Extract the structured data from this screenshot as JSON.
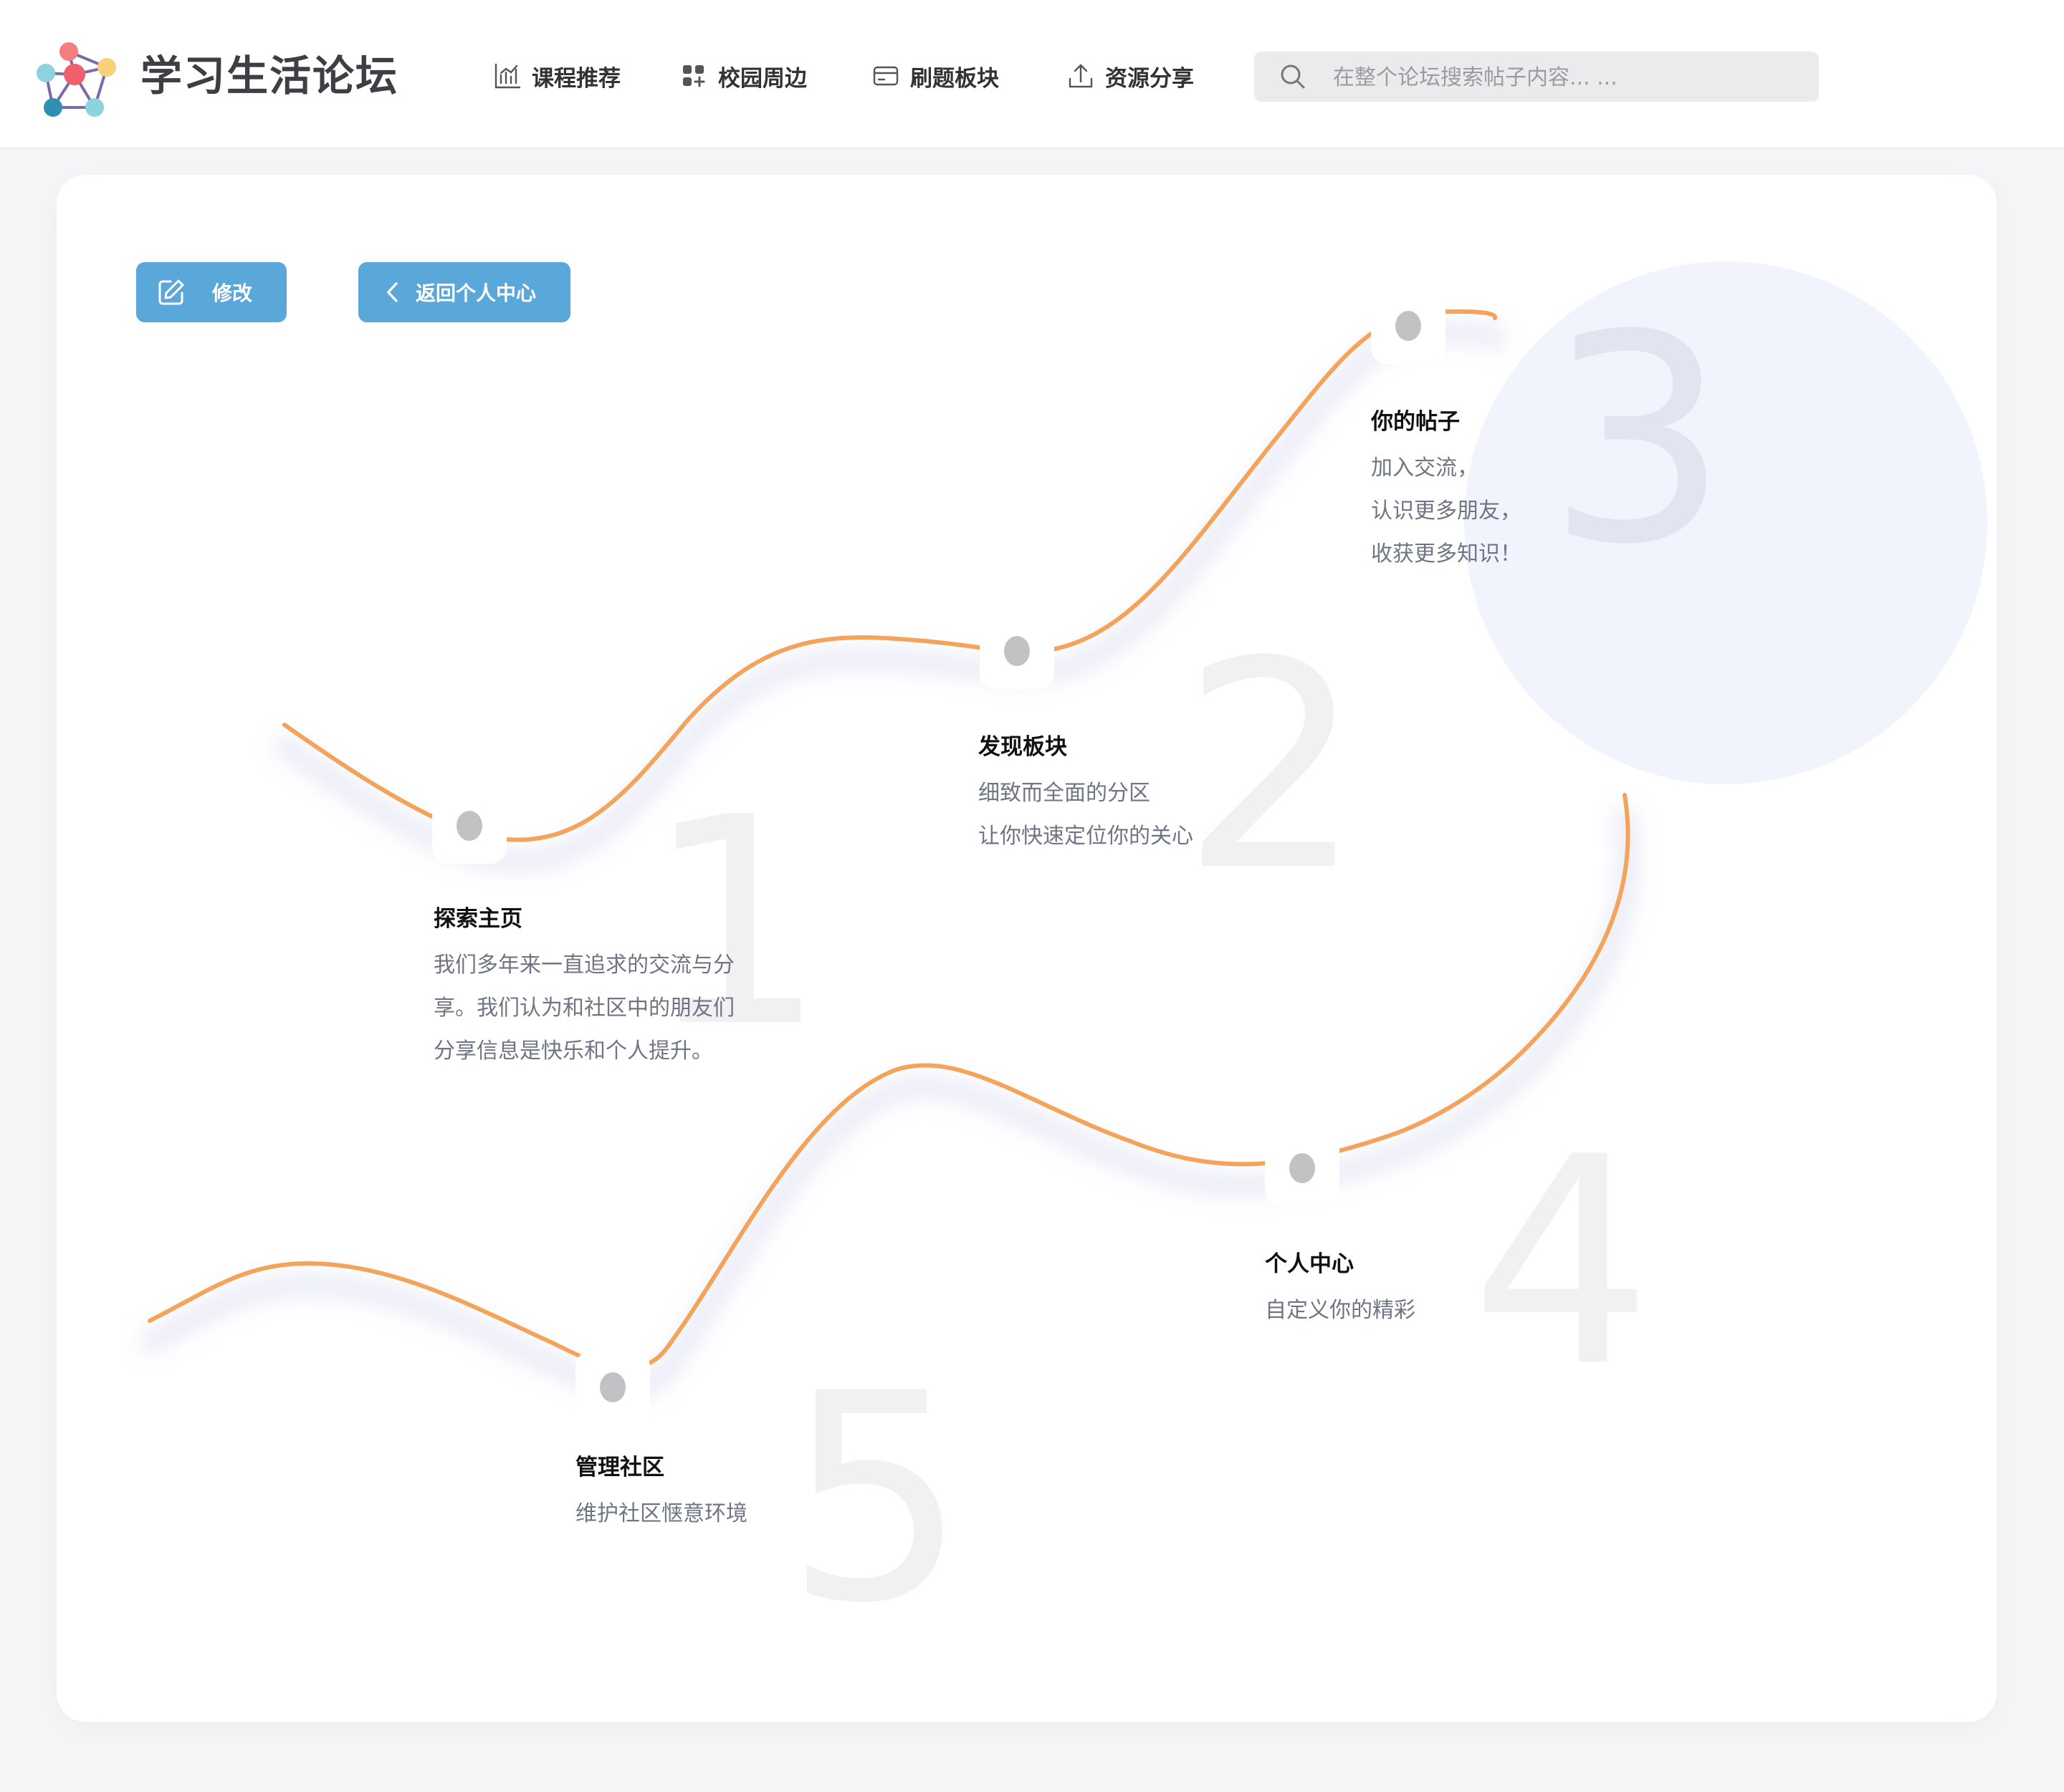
{
  "header": {
    "brand": "学习生活论坛",
    "nav": [
      {
        "label": "课程推荐",
        "icon": "bar-chart-icon"
      },
      {
        "label": "校园周边",
        "icon": "grid-icon"
      },
      {
        "label": "刷题板块",
        "icon": "card-icon"
      },
      {
        "label": "资源分享",
        "icon": "upload-icon"
      }
    ],
    "search": {
      "placeholder": "在整个论坛搜索帖子内容... ...",
      "icon": "search-icon"
    }
  },
  "actions": {
    "edit_label": "修改",
    "back_label": "返回个人中心"
  },
  "steps": [
    {
      "number": "1",
      "title": "探索主页",
      "lines": [
        "我们多年来一直追求的交流与分",
        "享。我们认为和社区中的朋友们",
        "分享信息是快乐和个人提升。"
      ]
    },
    {
      "number": "2",
      "title": "发现板块",
      "lines": [
        "细致而全面的分区",
        "让你快速定位你的关心"
      ]
    },
    {
      "number": "3",
      "title": "你的帖子",
      "lines": [
        "加入交流，",
        "认识更多朋友，",
        "收获更多知识！"
      ]
    },
    {
      "number": "4",
      "title": "个人中心",
      "lines": [
        "自定义你的精彩"
      ]
    },
    {
      "number": "5",
      "title": "管理社区",
      "lines": [
        "维护社区惬意环境"
      ]
    }
  ],
  "colors": {
    "curve": "#f4a35a",
    "button": "#5aa8da",
    "dot": "#c2c2c4"
  }
}
